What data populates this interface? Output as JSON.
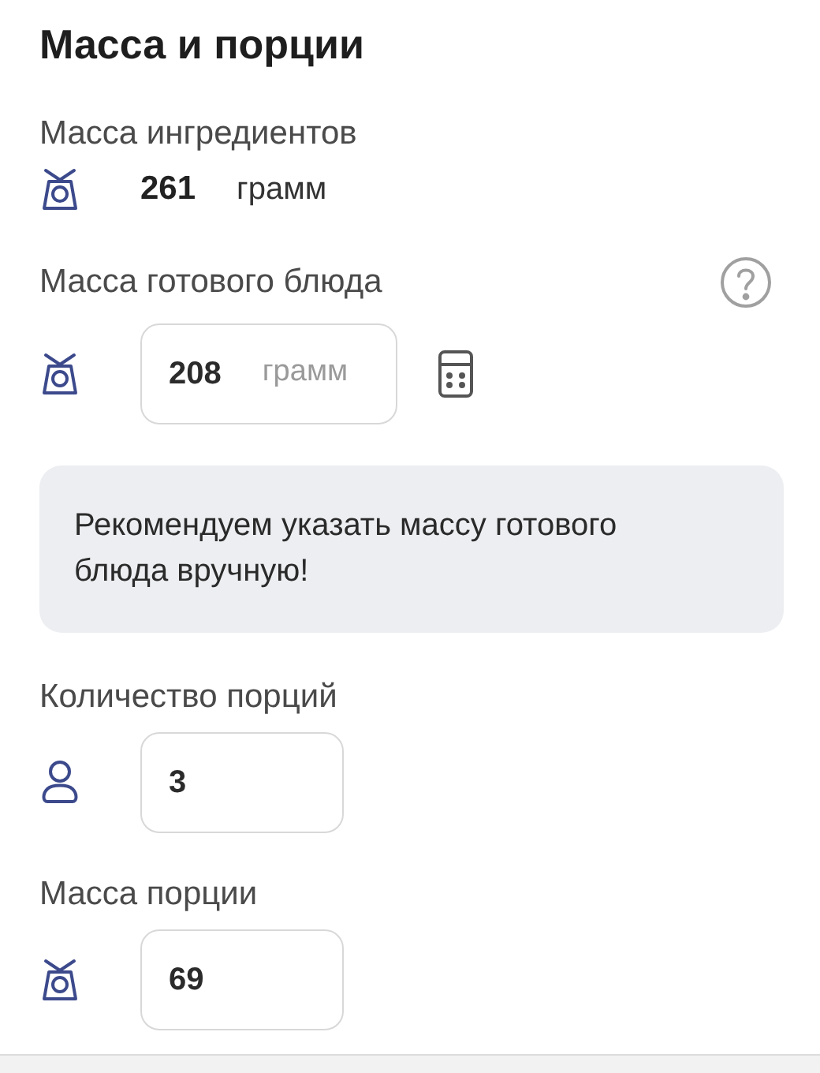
{
  "title": "Масса и порции",
  "sections": [
    {
      "kind": "weight_total",
      "label": "Масса ингредиентов",
      "value": "261",
      "unit": "грамм"
    },
    {
      "kind": "weight_field",
      "label": "Масса готового блюда",
      "value": "208",
      "unit": "грамм",
      "help": true,
      "calculator": true
    },
    {
      "kind": "note",
      "text": "Рекомендуем указать массу готового блюда вручную!"
    },
    {
      "kind": "count_field",
      "label": "Количество порций",
      "value": "3"
    },
    {
      "kind": "weight_field",
      "label": "Масса порции",
      "value": "69"
    }
  ]
}
